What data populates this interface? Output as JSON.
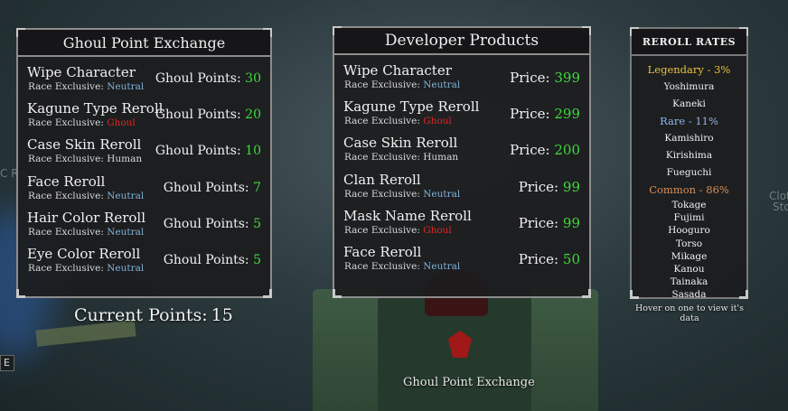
{
  "background": {
    "ghost_text_left": "C Rai",
    "ghost_text_right": "Cloth",
    "ghost_text_right2": "Stor",
    "left_box": "E"
  },
  "ghoul_exchange": {
    "title": "Ghoul Point Exchange",
    "cost_label": "Ghoul Points:",
    "race_label": "Race Exclusive:",
    "items": [
      {
        "name": "Wipe Character",
        "race": "Neutral",
        "race_class": "v-neutral",
        "cost": "30"
      },
      {
        "name": "Kagune Type Reroll",
        "race": "Ghoul",
        "race_class": "v-ghoul",
        "cost": "20"
      },
      {
        "name": "Case Skin Reroll",
        "race": "Human",
        "race_class": "v-human",
        "cost": "10"
      },
      {
        "name": "Face Reroll",
        "race": "Neutral",
        "race_class": "v-neutral",
        "cost": "7"
      },
      {
        "name": "Hair Color Reroll",
        "race": "Neutral",
        "race_class": "v-neutral",
        "cost": "5"
      },
      {
        "name": "Eye Color Reroll",
        "race": "Neutral",
        "race_class": "v-neutral",
        "cost": "5"
      }
    ]
  },
  "current_points": {
    "label": "Current Points:",
    "value": "15"
  },
  "developer_products": {
    "title": "Developer Products",
    "price_label": "Price:",
    "race_label": "Race Exclusive:",
    "items": [
      {
        "name": "Wipe Character",
        "race": "Neutral",
        "race_class": "v-neutral",
        "price": "399"
      },
      {
        "name": "Kagune Type Reroll",
        "race": "Ghoul",
        "race_class": "v-ghoul",
        "price": "299"
      },
      {
        "name": "Case Skin Reroll",
        "race": "Human",
        "race_class": "v-human",
        "price": "200"
      },
      {
        "name": "Clan Reroll",
        "race": "Neutral",
        "race_class": "v-neutral",
        "price": "99"
      },
      {
        "name": "Mask Name Reroll",
        "race": "Ghoul",
        "race_class": "v-ghoul",
        "price": "99"
      },
      {
        "name": "Face Reroll",
        "race": "Neutral",
        "race_class": "v-neutral",
        "price": "50"
      }
    ]
  },
  "exchange_label": "Ghoul Point Exchange",
  "reroll_rates": {
    "title": "REROLL RATES",
    "legendary": {
      "label": "Legendary - 3%",
      "items": [
        "Yoshimura",
        "Kaneki"
      ]
    },
    "rare": {
      "label": "Rare - 11%",
      "items": [
        "Kamishiro",
        "Kirishima",
        "Fueguchi"
      ]
    },
    "common": {
      "label": "Common - 86%",
      "items": [
        "Tokage",
        "Fujimi",
        "Hooguro",
        "Torso",
        "Mikage",
        "Kanou",
        "Tainaka",
        "Sasada"
      ]
    }
  },
  "hover_hint": "Hover on one to view it's data",
  "colors": {
    "accent_green": "#3fd83f",
    "neutral_blue": "#7fb3d9",
    "ghoul_red": "#e02626",
    "legendary_gold": "#e7c240",
    "rare_blue": "#8fb6e6",
    "common_orange": "#d9925a"
  }
}
